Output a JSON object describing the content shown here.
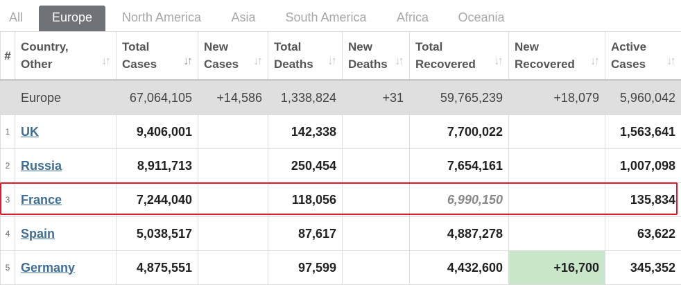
{
  "tabs": [
    {
      "label": "All"
    },
    {
      "label": "Europe",
      "active": true
    },
    {
      "label": "North America"
    },
    {
      "label": "Asia"
    },
    {
      "label": "South America"
    },
    {
      "label": "Africa"
    },
    {
      "label": "Oceania"
    }
  ],
  "headers": {
    "num": "#",
    "country": [
      "Country,",
      "Other"
    ],
    "total_cases": [
      "Total",
      "Cases"
    ],
    "new_cases": [
      "New",
      "Cases"
    ],
    "total_deaths": [
      "Total",
      "Deaths"
    ],
    "new_deaths": [
      "New",
      "Deaths"
    ],
    "total_recovered": [
      "Total",
      "Recovered"
    ],
    "new_recovered": [
      "New",
      "Recovered"
    ],
    "active_cases": [
      "Active",
      "Cases"
    ]
  },
  "sort_glyph": "↓↑",
  "total_row": {
    "country": "Europe",
    "total_cases": "67,064,105",
    "new_cases": "+14,586",
    "total_deaths": "1,338,824",
    "new_deaths": "+31",
    "total_recovered": "59,765,239",
    "new_recovered": "+18,079",
    "active_cases": "5,960,042"
  },
  "rows": [
    {
      "num": "1",
      "country": "UK",
      "total_cases": "9,406,001",
      "new_cases": "",
      "total_deaths": "142,338",
      "new_deaths": "",
      "total_recovered": "7,700,022",
      "new_recovered": "",
      "active_cases": "1,563,641"
    },
    {
      "num": "2",
      "country": "Russia",
      "total_cases": "8,911,713",
      "new_cases": "",
      "total_deaths": "250,454",
      "new_deaths": "",
      "total_recovered": "7,654,161",
      "new_recovered": "",
      "active_cases": "1,007,098"
    },
    {
      "num": "3",
      "country": "France",
      "total_cases": "7,244,040",
      "new_cases": "",
      "total_deaths": "118,056",
      "new_deaths": "",
      "total_recovered": "6,990,150",
      "new_recovered": "",
      "active_cases": "135,834",
      "highlighted": true
    },
    {
      "num": "4",
      "country": "Spain",
      "total_cases": "5,038,517",
      "new_cases": "",
      "total_deaths": "87,617",
      "new_deaths": "",
      "total_recovered": "4,887,278",
      "new_recovered": "",
      "active_cases": "63,622"
    },
    {
      "num": "5",
      "country": "Germany",
      "total_cases": "4,875,551",
      "new_cases": "",
      "total_deaths": "97,599",
      "new_deaths": "",
      "total_recovered": "4,432,600",
      "new_recovered": "+16,700",
      "active_cases": "345,352"
    }
  ],
  "colors": {
    "highlight_border": "#e0182a",
    "active_tab": "#6f7277",
    "link": "#3f6f96",
    "new_recovered_bg": "#c8e6c9",
    "total_row_bg": "#dfdfdf"
  }
}
